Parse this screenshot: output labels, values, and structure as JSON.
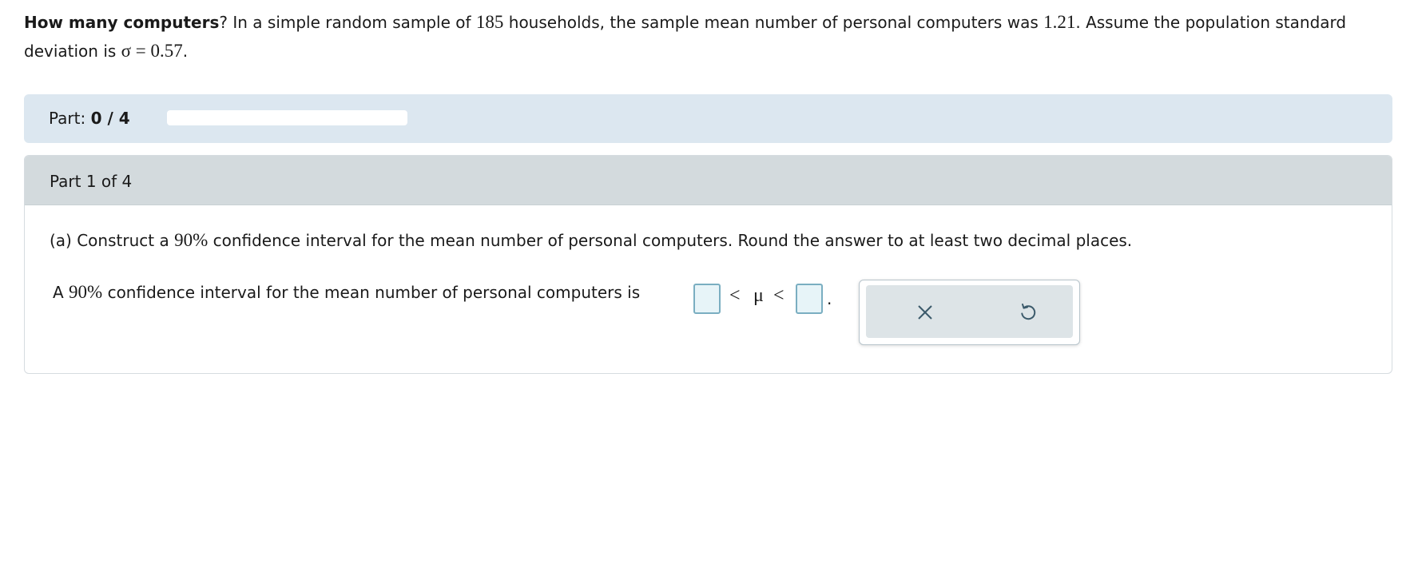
{
  "problem": {
    "title": "How many computers",
    "after_title": "? In a simple random sample of ",
    "n": "185",
    "mid1": " households, the sample mean number of personal computers was ",
    "mean": "1.21",
    "mid2": ". Assume the population standard deviation is ",
    "sigma": "σ = 0.57",
    "end": "."
  },
  "progress": {
    "label": "Part:",
    "value": "0 / 4",
    "fraction": 0
  },
  "part": {
    "header": "Part 1 of 4",
    "q_prefix": "(a) Construct a ",
    "q_pct": "90%",
    "q_suffix": " confidence interval for the mean number of personal computers. Round the answer to at least two decimal places.",
    "a_prefix": "A ",
    "a_pct": "90%",
    "a_suffix": " confidence interval for the mean number of personal computers is",
    "lower_value": "",
    "upper_value": "",
    "lt1": "<",
    "mu": "μ",
    "lt2": "<",
    "period": "."
  },
  "tools": {
    "clear_icon": "close-icon",
    "undo_icon": "undo-icon",
    "icon_color": "#3b5a6b"
  }
}
